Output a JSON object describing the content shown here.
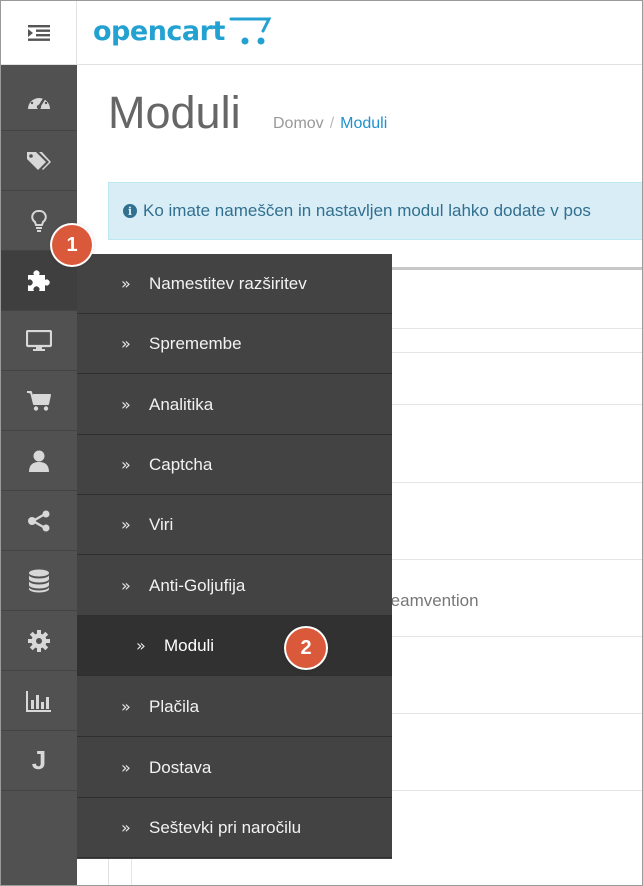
{
  "brand": {
    "logo_text": "opencart",
    "accent": "#23a1d1"
  },
  "header": {
    "menu_toggle_icon": "hamburger-indent-icon"
  },
  "sidebar": {
    "items": [
      {
        "icon": "dashboard-icon"
      },
      {
        "icon": "tags-icon"
      },
      {
        "icon": "lightbulb-icon"
      },
      {
        "icon": "puzzle-icon",
        "active": true
      },
      {
        "icon": "desktop-icon"
      },
      {
        "icon": "shopping-cart-icon"
      },
      {
        "icon": "user-icon"
      },
      {
        "icon": "share-icon"
      },
      {
        "icon": "database-icon"
      },
      {
        "icon": "gear-icon"
      },
      {
        "icon": "bar-chart-icon"
      },
      {
        "icon": "j-icon",
        "label": "J"
      }
    ]
  },
  "page": {
    "title": "Moduli",
    "breadcrumb": {
      "home": "Domov",
      "separator": "/",
      "current": "Moduli"
    },
    "alert": "Ko imate nameščen in nastavljen modul lahko dodate v pos",
    "background_text": "reamvention"
  },
  "flyout": {
    "items": [
      {
        "label": "Namestitev razširitev"
      },
      {
        "label": "Spremembe"
      },
      {
        "label": "Analitika"
      },
      {
        "label": "Captcha"
      },
      {
        "label": "Viri"
      },
      {
        "label": "Anti-Goljufija"
      },
      {
        "label": "Moduli",
        "sub": true
      },
      {
        "label": "Plačila"
      },
      {
        "label": "Dostava"
      },
      {
        "label": "Seštevki pri naročilu"
      }
    ]
  },
  "badges": {
    "first": "1",
    "second": "2",
    "color": "#d9593a"
  }
}
